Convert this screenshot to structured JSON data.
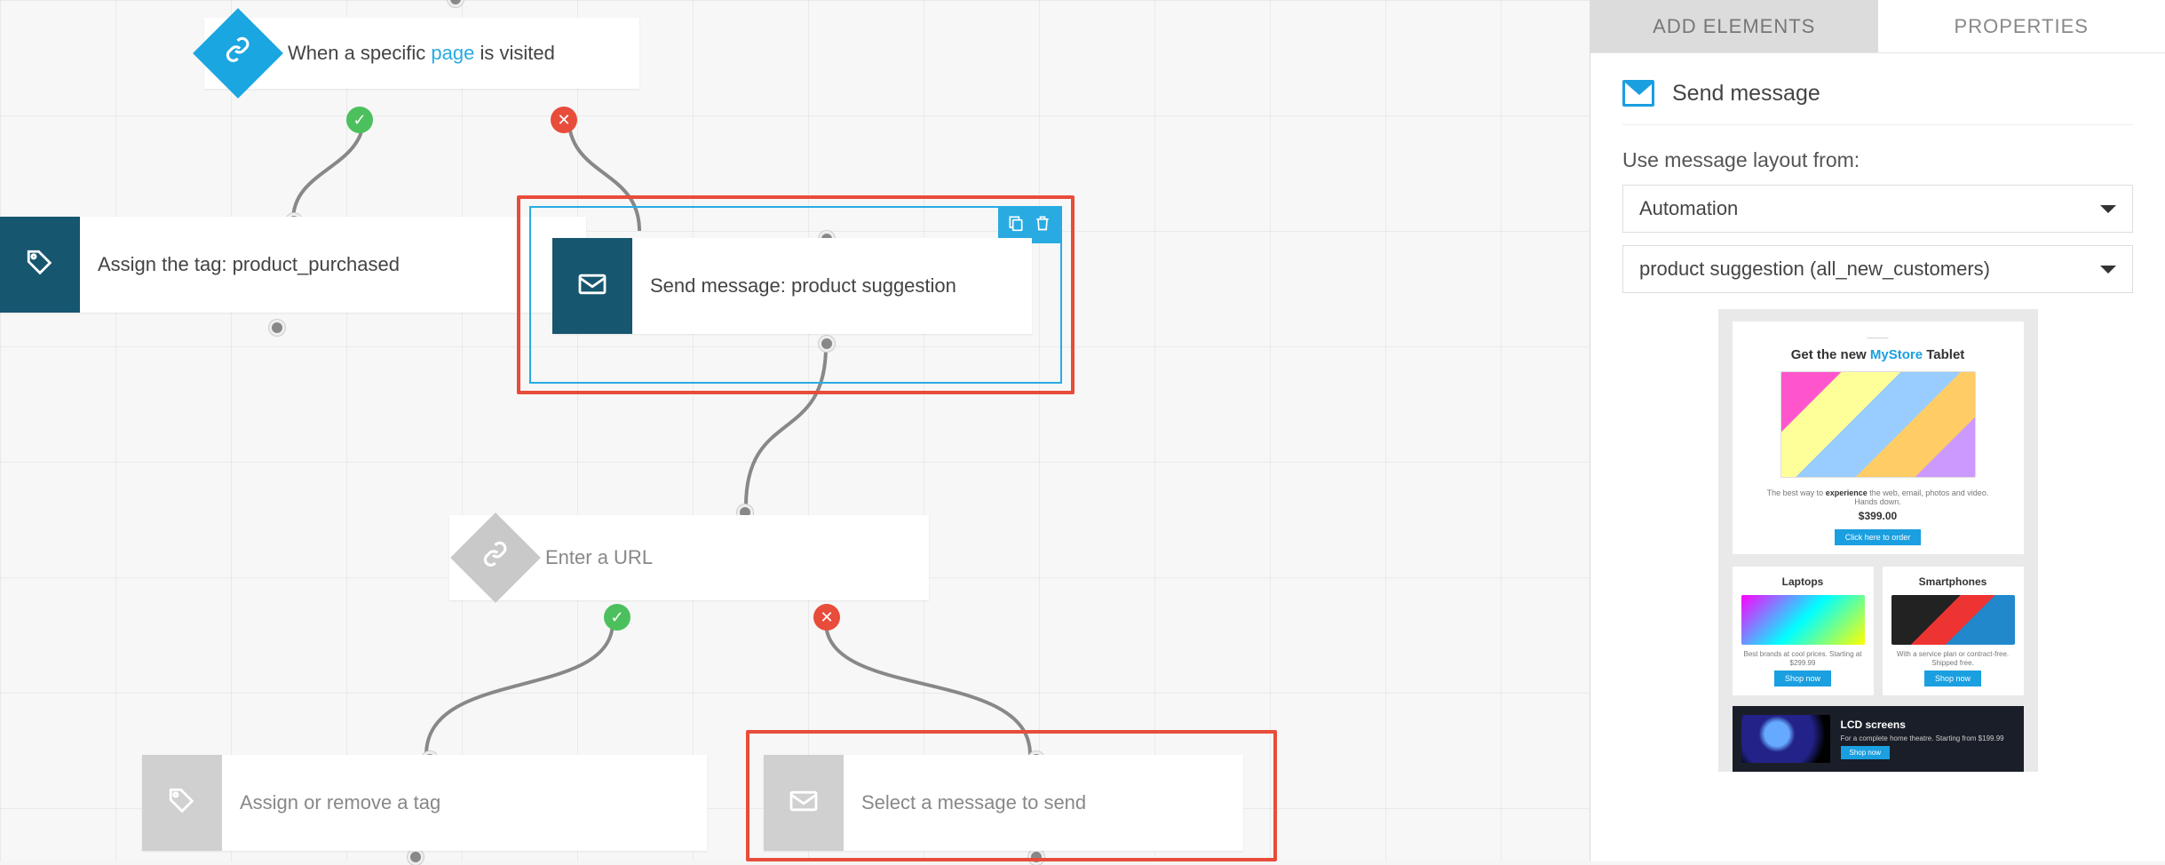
{
  "canvas": {
    "trigger": {
      "prefix": "When a specific ",
      "link": "page",
      "suffix": " is visited"
    },
    "assign_tag": {
      "label": "Assign the tag: product_purchased"
    },
    "send_msg": {
      "label": "Send message: product suggestion"
    },
    "url_cond": {
      "label": "Enter a URL"
    },
    "assign_remove": {
      "label": "Assign or remove a tag"
    },
    "select_msg": {
      "label": "Select a message to send"
    }
  },
  "sidebar": {
    "tabs": {
      "add": "ADD ELEMENTS",
      "props": "PROPERTIES"
    },
    "title": "Send message",
    "layout_label": "Use message layout from:",
    "select1": "Automation",
    "select2": "product suggestion (all_new_customers)",
    "preview": {
      "pretitle": "",
      "title_pre": "Get the new ",
      "title_brand": "MyStore",
      "title_post": " Tablet",
      "desc_pre": "The best way to ",
      "desc_bold": "experience",
      "desc_post": " the web, email, photos and video. Hands down.",
      "price": "$399.00",
      "cta": "Click here to order",
      "col1": {
        "title": "Laptops",
        "desc": "Best brands at cool prices. Starting at $299.99",
        "btn": "Shop now"
      },
      "col2": {
        "title": "Smartphones",
        "desc": "With a service plan or contract-free. Shipped free.",
        "btn": "Shop now"
      },
      "dark": {
        "title": "LCD screens",
        "desc": "For a complete home theatre. Starting from $199.99",
        "btn": "Shop now"
      }
    }
  }
}
